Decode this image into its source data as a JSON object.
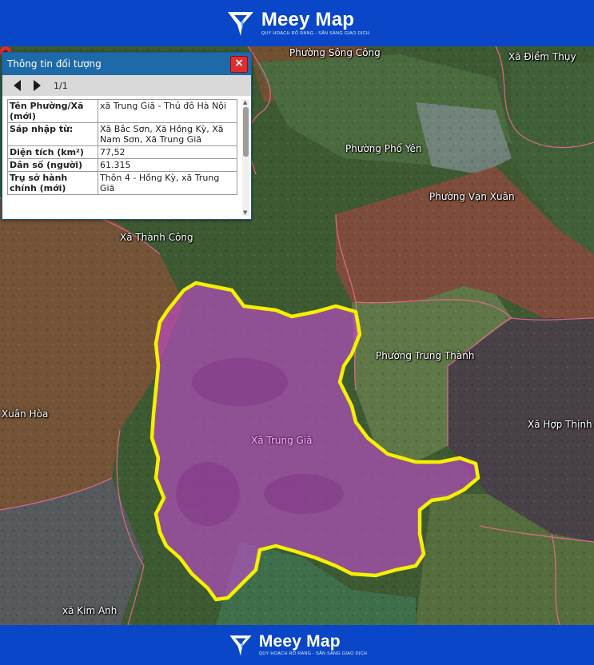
{
  "brand": {
    "name": "Meey Map",
    "tagline": "QUY HOẠCH RÕ RÀNG - SẴN SÀNG GIAO DỊCH"
  },
  "panel": {
    "title": "Thông tin đối tượng",
    "close_label": "×",
    "pager": "1/1",
    "rows": [
      {
        "key": "Tên Phường/Xã (mới)",
        "value": "xã Trung Giã - Thủ đô Hà Nội"
      },
      {
        "key": "Sáp nhập từ:",
        "value": "Xã Bắc Sơn, Xã Hồng Kỳ, Xã Nam Sơn, Xã Trung Giã"
      },
      {
        "key": "Diện tích (km²)",
        "value": "77,52"
      },
      {
        "key": "Dân số (người)",
        "value": "61.315"
      },
      {
        "key": "Trụ sở hành chính (mới)",
        "value": "Thôn 4 - Hồng Kỳ, xã Trung Giã"
      }
    ]
  },
  "map": {
    "labels": {
      "song_cong": "Phường Sông Công",
      "diem_thuy": "Xã Điềm Thụy",
      "pho_yen": "Phường Phổ Yên",
      "van_xuan": "Phường Vạn Xuân",
      "thanh_cong": "Xã Thành Công",
      "trung_thanh": "Phường Trung Thành",
      "xuan_hoa": "Xuân Hòa",
      "hop_thinh": "Xã Hợp Thịnh",
      "trung_gia": "Xã Trung Giã",
      "kim_anh": "xã Kim Anh"
    },
    "colors": {
      "highlight_fill": "#c44bd0",
      "highlight_border": "#f5f000",
      "pin": "#e02d2d"
    }
  }
}
